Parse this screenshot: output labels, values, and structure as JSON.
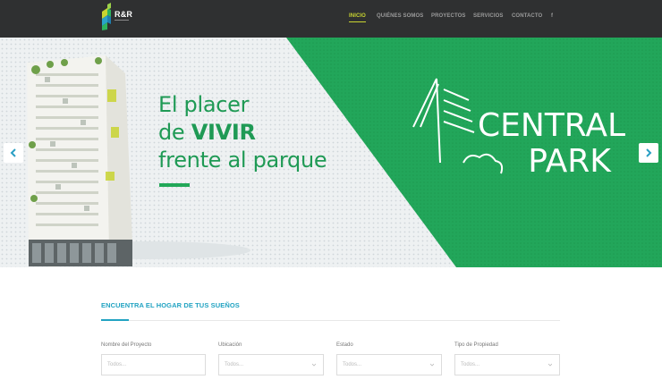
{
  "header": {
    "logo_text": "R&R",
    "nav": [
      {
        "label": "INICIO",
        "active": true
      },
      {
        "label": "QUIÉNES SOMOS",
        "active": false
      },
      {
        "label": "PROYECTOS",
        "active": false
      },
      {
        "label": "SERVICIOS",
        "active": false
      },
      {
        "label": "CONTACTO",
        "active": false
      },
      {
        "label": "f",
        "active": false
      }
    ]
  },
  "hero": {
    "slogan_line1": "El placer",
    "slogan_line2_prefix": "de ",
    "slogan_line2_bold": "VIVIR",
    "slogan_line3": "frente al parque",
    "brand_line1": "CENTRAL",
    "brand_line2": "PARK",
    "colors": {
      "green": "#1f9a55",
      "green_bg": "#22a65a"
    }
  },
  "search": {
    "title": "ENCUENTRA EL HOGAR DE TUS SUEÑOS",
    "fields": [
      {
        "label": "Nombre del Proyecto",
        "placeholder": "Todos...",
        "type": "text"
      },
      {
        "label": "Ubicación",
        "placeholder": "Todos...",
        "type": "select"
      },
      {
        "label": "Estado",
        "placeholder": "Todos...",
        "type": "select"
      },
      {
        "label": "Tipo de Propiedad",
        "placeholder": "Todos...",
        "type": "select"
      }
    ],
    "accent": "#22a3c2"
  }
}
